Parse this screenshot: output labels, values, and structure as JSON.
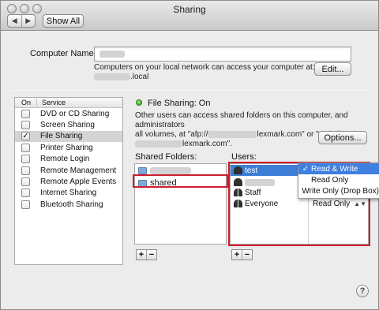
{
  "window": {
    "title": "Sharing"
  },
  "toolbar": {
    "back_icon": "◀",
    "forward_icon": "▶",
    "show_all_label": "Show All"
  },
  "computer_name": {
    "label": "Computer Name:",
    "value": "",
    "note_line1": "Computers on your local network can access your computer at:",
    "note_suffix": ".local",
    "edit_label": "Edit..."
  },
  "services": {
    "col_on": "On",
    "col_service": "Service",
    "items": [
      {
        "label": "DVD or CD Sharing",
        "checked": false
      },
      {
        "label": "Screen Sharing",
        "checked": false
      },
      {
        "label": "File Sharing",
        "checked": true,
        "selected": true
      },
      {
        "label": "Printer Sharing",
        "checked": false
      },
      {
        "label": "Remote Login",
        "checked": false
      },
      {
        "label": "Remote Management",
        "checked": false
      },
      {
        "label": "Remote Apple Events",
        "checked": false
      },
      {
        "label": "Internet Sharing",
        "checked": false
      },
      {
        "label": "Bluetooth Sharing",
        "checked": false
      }
    ]
  },
  "file_sharing": {
    "status": "File Sharing: On",
    "status_color": "#3aa81f",
    "desc_line1": "Other users can access shared folders on this computer, and administrators",
    "desc_line2_prefix": "all volumes, at \"afp://",
    "desc_line2_mid": "lexmark.com\" or \"smb://",
    "desc_line3_suffix": "lexmark.com\".",
    "options_label": "Options..."
  },
  "shared_folders": {
    "label": "Shared Folders:",
    "items": [
      "",
      "shared"
    ]
  },
  "users": {
    "label": "Users:",
    "items": [
      {
        "name": "test",
        "privilege": ""
      },
      {
        "name": "",
        "privilege": ""
      },
      {
        "name": "Staff",
        "privilege": ""
      },
      {
        "name": "Everyone",
        "privilege": "Read Only"
      }
    ]
  },
  "privilege_menu": {
    "items": [
      {
        "label": "Read & Write",
        "checked": true
      },
      {
        "label": "Read Only",
        "checked": false
      },
      {
        "label": "Write Only (Drop Box)",
        "checked": false
      }
    ]
  },
  "controls": {
    "add": "+",
    "remove": "−",
    "help": "?",
    "check_mark": "✓",
    "up_down": "▲▼"
  },
  "highlight_color": "#cc1e2f"
}
